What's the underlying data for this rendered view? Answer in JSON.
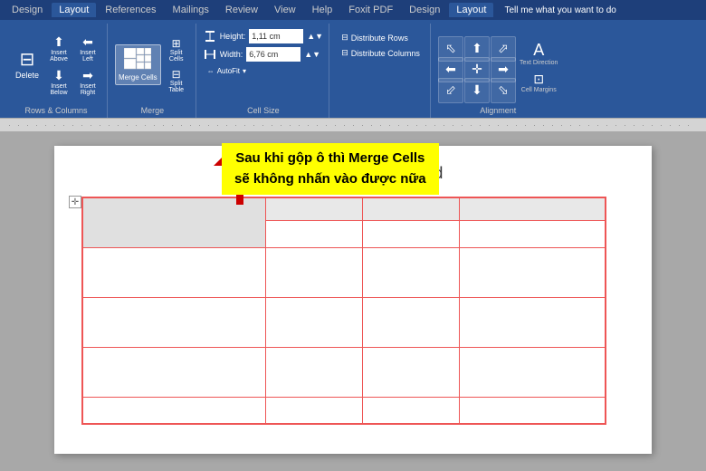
{
  "ribbon": {
    "tabs": [
      "Design",
      "Layout"
    ],
    "active_tab": "Layout",
    "groups": {
      "rows_columns": {
        "label": "Rows & Columns",
        "buttons": [
          "Delete",
          "Insert Above",
          "Insert Below",
          "Insert Left",
          "Insert Right"
        ]
      },
      "merge": {
        "label": "Merge",
        "buttons": [
          "Merge Cells",
          "Split Cells",
          "Split Table"
        ]
      },
      "cell_size": {
        "label": "Cell Size",
        "height_label": "Height:",
        "height_value": "1,11 cm",
        "width_label": "Width:",
        "width_value": "6,76 cm",
        "autofit_label": "AutoFit"
      },
      "distribute": {
        "rows_label": "Distribute Rows",
        "cols_label": "Distribute Columns"
      },
      "alignment": {
        "label": "Alignment",
        "text_direction_label": "Text Direction",
        "cell_margins_label": "Cell Margins"
      }
    }
  },
  "search_bar": {
    "placeholder": "Tell me what you want to do"
  },
  "document": {
    "title": "Cách Gộp Ô Trong Word"
  },
  "callout": {
    "line1": "Sau khi gộp ô thì Merge Cells",
    "line2": "sẽ không nhấn vào được nữa"
  },
  "colors": {
    "accent": "#2b579a",
    "tab_bg": "#1e3f7a",
    "highlight": "#ffff00",
    "arrow": "#cc0000",
    "table_border": "#e55555"
  }
}
